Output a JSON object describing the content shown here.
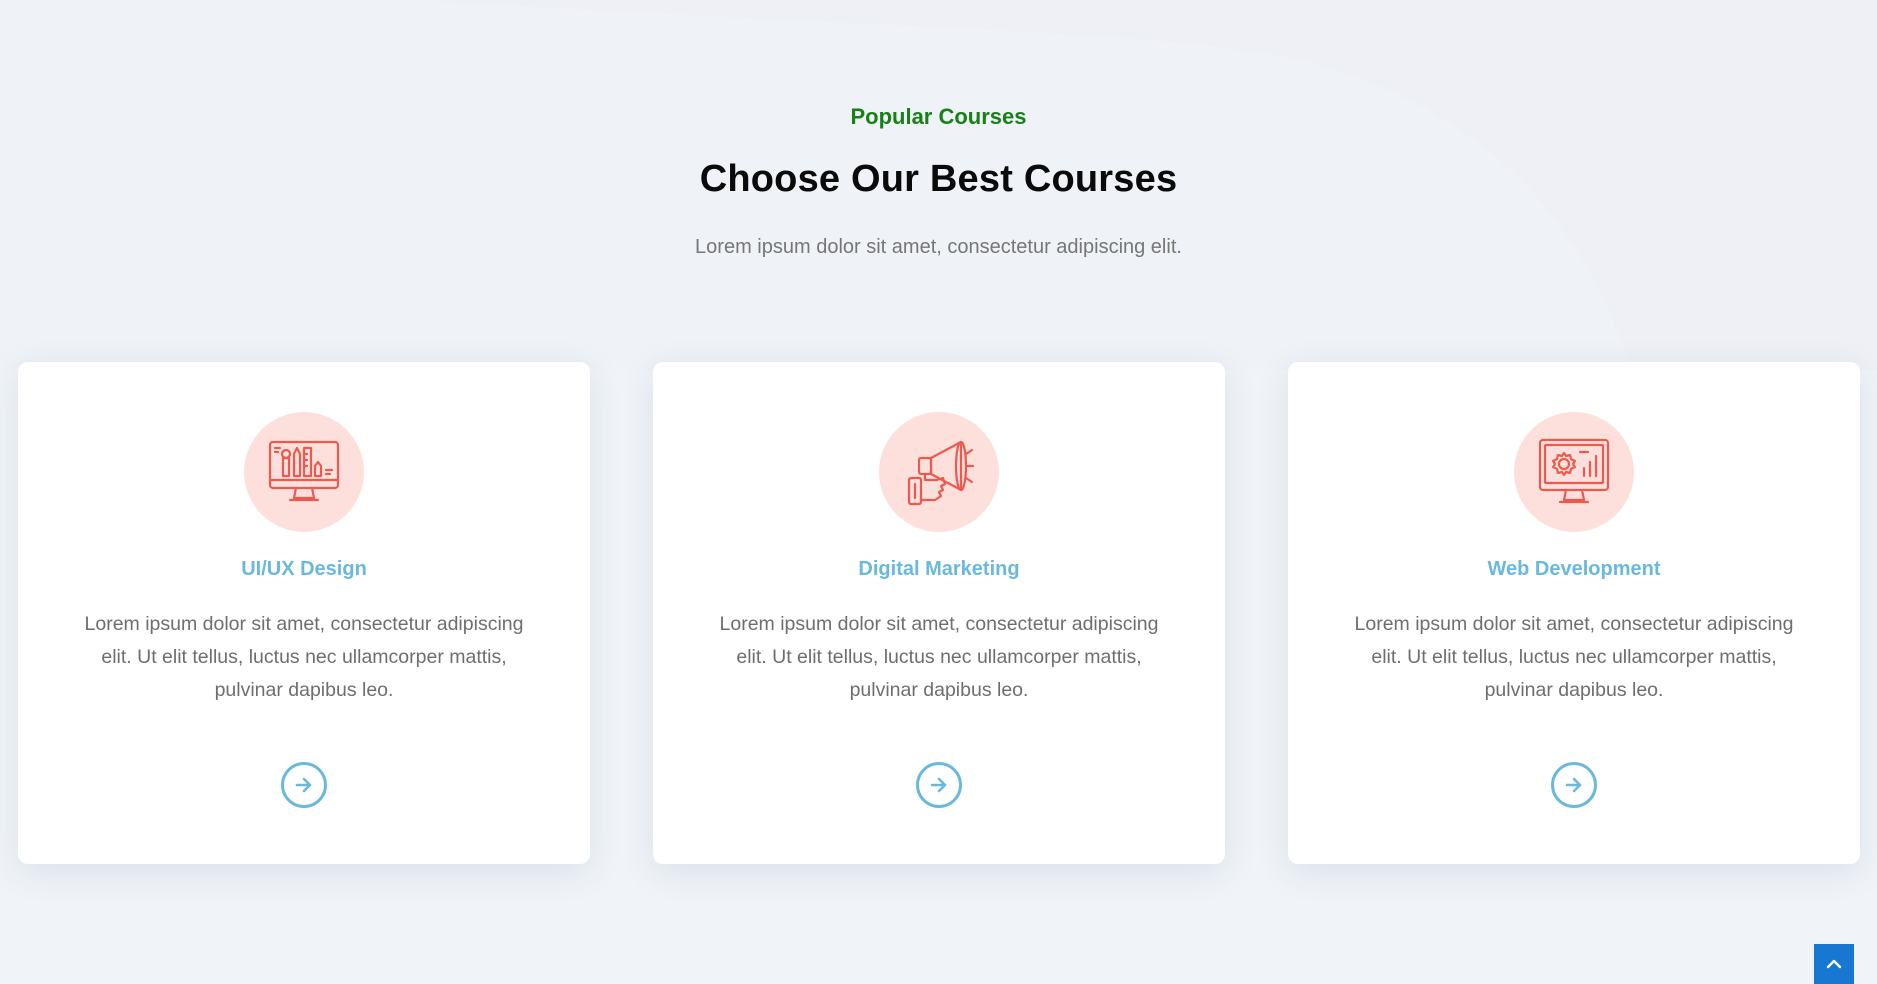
{
  "section": {
    "eyebrow": "Popular Courses",
    "title": "Choose Our Best Courses",
    "subtitle": "Lorem ipsum dolor sit amet, consectetur adipiscing elit."
  },
  "courses": [
    {
      "title": "UI/UX Design",
      "description": "Lorem ipsum dolor sit amet, consectetur adipiscing elit. Ut elit tellus, luctus nec ullamcorper mattis, pulvinar dapibus leo.",
      "icon": "design-monitor-icon"
    },
    {
      "title": "Digital Marketing",
      "description": "Lorem ipsum dolor sit amet, consectetur adipiscing elit. Ut elit tellus, luctus nec ullamcorper mattis, pulvinar dapibus leo.",
      "icon": "megaphone-icon"
    },
    {
      "title": "Web Development",
      "description": "Lorem ipsum dolor sit amet, consectetur adipiscing elit. Ut elit tellus, luctus nec ullamcorper mattis, pulvinar dapibus leo.",
      "icon": "gear-monitor-icon"
    }
  ],
  "colors": {
    "eyebrow": "#198019",
    "card_title": "#6ab9dc",
    "icon_circle": "#fde0dc",
    "icon_stroke": "#ec5a4f",
    "scroll_top": "#1878d1"
  },
  "scroll_top": {
    "icon": "chevron-up-icon"
  }
}
